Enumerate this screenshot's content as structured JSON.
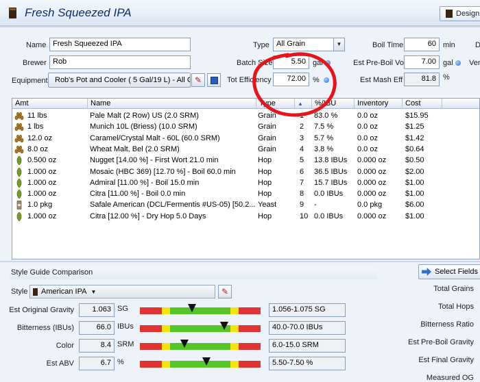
{
  "window": {
    "title": "Fresh Squeezed IPA",
    "design_button": "Design"
  },
  "form": {
    "name_label": "Name",
    "name_value": "Fresh Squeezed IPA",
    "brewer_label": "Brewer",
    "brewer_value": "Rob",
    "equipment_label": "Equipment",
    "equipment_value": "Rob's Pot and Cooler ( 5 Gal/19 L) - All G",
    "type_label": "Type",
    "type_value": "All Grain",
    "batch_size_label": "Batch Size",
    "batch_size_value": "5.50",
    "batch_size_unit": "gal",
    "tot_eff_label": "Tot Efficiency",
    "tot_eff_value": "72.00",
    "tot_eff_unit": "%",
    "boil_time_label": "Boil Time",
    "boil_time_value": "60",
    "boil_time_unit": "min",
    "pre_boil_label": "Est Pre-Boil Vol",
    "pre_boil_value": "7.00",
    "pre_boil_unit": "gal",
    "mash_eff_label": "Est Mash Eff",
    "mash_eff_value": "81.8",
    "mash_eff_unit": "%",
    "cut_right_1": "D",
    "cut_right_2": "Ver"
  },
  "grid": {
    "columns": [
      "Amt",
      "Name",
      "Type",
      "#",
      "%/IBU",
      "Inventory",
      "Cost"
    ],
    "rows": [
      {
        "icon": "grain",
        "amt": "11 lbs",
        "name": "Pale Malt (2 Row) US (2.0 SRM)",
        "type": "Grain",
        "num": "1",
        "pct": "83.0 %",
        "inv": "0.0 oz",
        "cost": "$15.95"
      },
      {
        "icon": "grain",
        "amt": "1 lbs",
        "name": "Munich 10L (Briess) (10.0 SRM)",
        "type": "Grain",
        "num": "2",
        "pct": "7.5 %",
        "inv": "0.0 oz",
        "cost": "$1.25"
      },
      {
        "icon": "grain",
        "amt": "12.0 oz",
        "name": "Caramel/Crystal Malt - 60L (60.0 SRM)",
        "type": "Grain",
        "num": "3",
        "pct": "5.7 %",
        "inv": "0.0 oz",
        "cost": "$1.42"
      },
      {
        "icon": "grain",
        "amt": "8.0 oz",
        "name": "Wheat Malt, Bel (2.0 SRM)",
        "type": "Grain",
        "num": "4",
        "pct": "3.8 %",
        "inv": "0.0 oz",
        "cost": "$0.64"
      },
      {
        "icon": "hop",
        "amt": "0.500 oz",
        "name": "Nugget [14.00 %] - First Wort 21.0 min",
        "type": "Hop",
        "num": "5",
        "pct": "13.8 IBUs",
        "inv": "0.000 oz",
        "cost": "$0.50"
      },
      {
        "icon": "hop",
        "amt": "1.000 oz",
        "name": "Mosaic (HBC 369) [12.70 %] - Boil 60.0 min",
        "type": "Hop",
        "num": "6",
        "pct": "36.5 IBUs",
        "inv": "0.000 oz",
        "cost": "$2.00"
      },
      {
        "icon": "hop",
        "amt": "1.000 oz",
        "name": "Admiral [11.00 %] - Boil 15.0 min",
        "type": "Hop",
        "num": "7",
        "pct": "15.7 IBUs",
        "inv": "0.000 oz",
        "cost": "$1.00"
      },
      {
        "icon": "hop",
        "amt": "1.000 oz",
        "name": "Citra [11.00 %] - Boil 0.0 min",
        "type": "Hop",
        "num": "8",
        "pct": "0.0 IBUs",
        "inv": "0.000 oz",
        "cost": "$1.00"
      },
      {
        "icon": "yeast",
        "amt": "1.0 pkg",
        "name": "Safale American  (DCL/Fermentis #US-05) [50.2...",
        "type": "Yeast",
        "num": "9",
        "pct": "-",
        "inv": "0.0 pkg",
        "cost": "$6.00"
      },
      {
        "icon": "hop",
        "amt": "1.000 oz",
        "name": "Citra [12.00 %] - Dry Hop 5.0 Days",
        "type": "Hop",
        "num": "10",
        "pct": "0.0 IBUs",
        "inv": "0.000 oz",
        "cost": "$1.00"
      }
    ]
  },
  "style_guide": {
    "section_title": "Style Guide Comparison",
    "select_fields_button": "Select Fields",
    "style_label": "Style",
    "style_value": "American IPA",
    "metrics": [
      {
        "label": "Est Original Gravity",
        "value": "1.063",
        "unit": "SG",
        "range": "1.056-1.075 SG",
        "level": 0.43
      },
      {
        "label": "Bitterness (IBUs)",
        "value": "66.0",
        "unit": "IBUs",
        "range": "40.0-70.0 IBUs",
        "level": 0.7
      },
      {
        "label": "Color",
        "value": "8.4",
        "unit": "SRM",
        "range": "6.0-15.0 SRM",
        "level": 0.37
      },
      {
        "label": "Est ABV",
        "value": "6.7",
        "unit": "%",
        "range": "5.50-7.50 %",
        "level": 0.55
      }
    ]
  },
  "right_panel": {
    "items": [
      "Total Grains",
      "Total Hops",
      "Bitterness Ratio",
      "Est Pre-Boil Gravity",
      "Est Final Gravity",
      "Measured OG"
    ]
  },
  "colors": {
    "annotation_circle": "#e8141c",
    "header_blue": "#0c2d6b",
    "bar_red": "#e03434",
    "bar_yellow": "#f4e40e",
    "bar_green": "#54c629"
  }
}
